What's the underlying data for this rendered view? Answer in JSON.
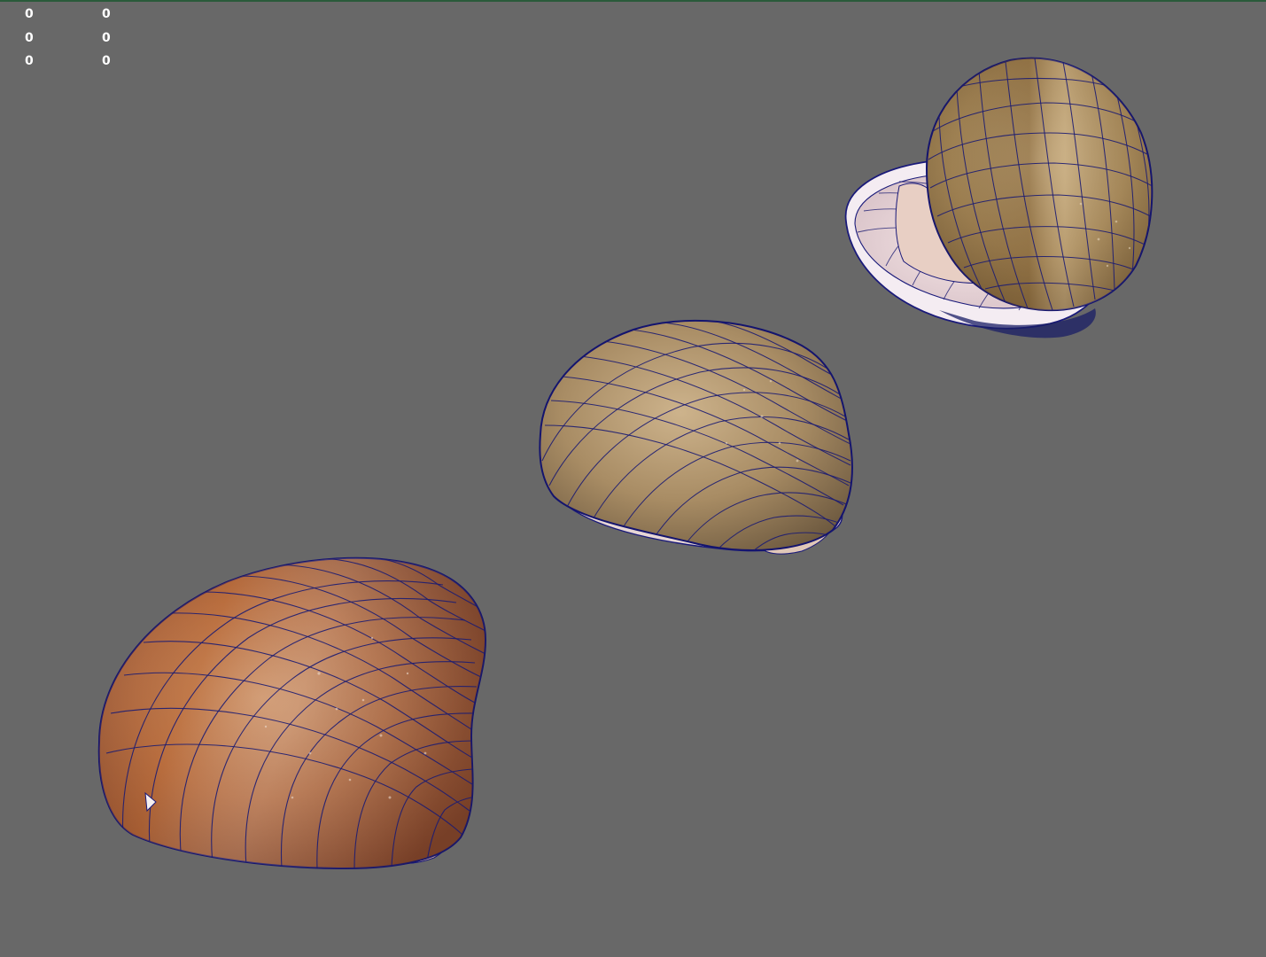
{
  "viewport": {
    "background": "#686868",
    "wire_color": "#101070",
    "hud": {
      "row1": {
        "a": "0",
        "b": "0"
      },
      "row2": {
        "a": "0",
        "b": "0"
      },
      "row3": {
        "a": "0",
        "b": "0"
      }
    },
    "objects": [
      {
        "name": "clam-shell-large",
        "shell_colors": [
          "#c9895c",
          "#a4603c",
          "#7a4028"
        ]
      },
      {
        "name": "clam-shell-medium",
        "shell_colors": [
          "#c4aa84",
          "#a98e66",
          "#7b6446"
        ]
      },
      {
        "name": "clam-shell-open",
        "shell_colors": [
          "#c8ae80",
          "#a68a5c",
          "#6f5734"
        ],
        "inner_color": "#f3e6ea"
      }
    ]
  }
}
